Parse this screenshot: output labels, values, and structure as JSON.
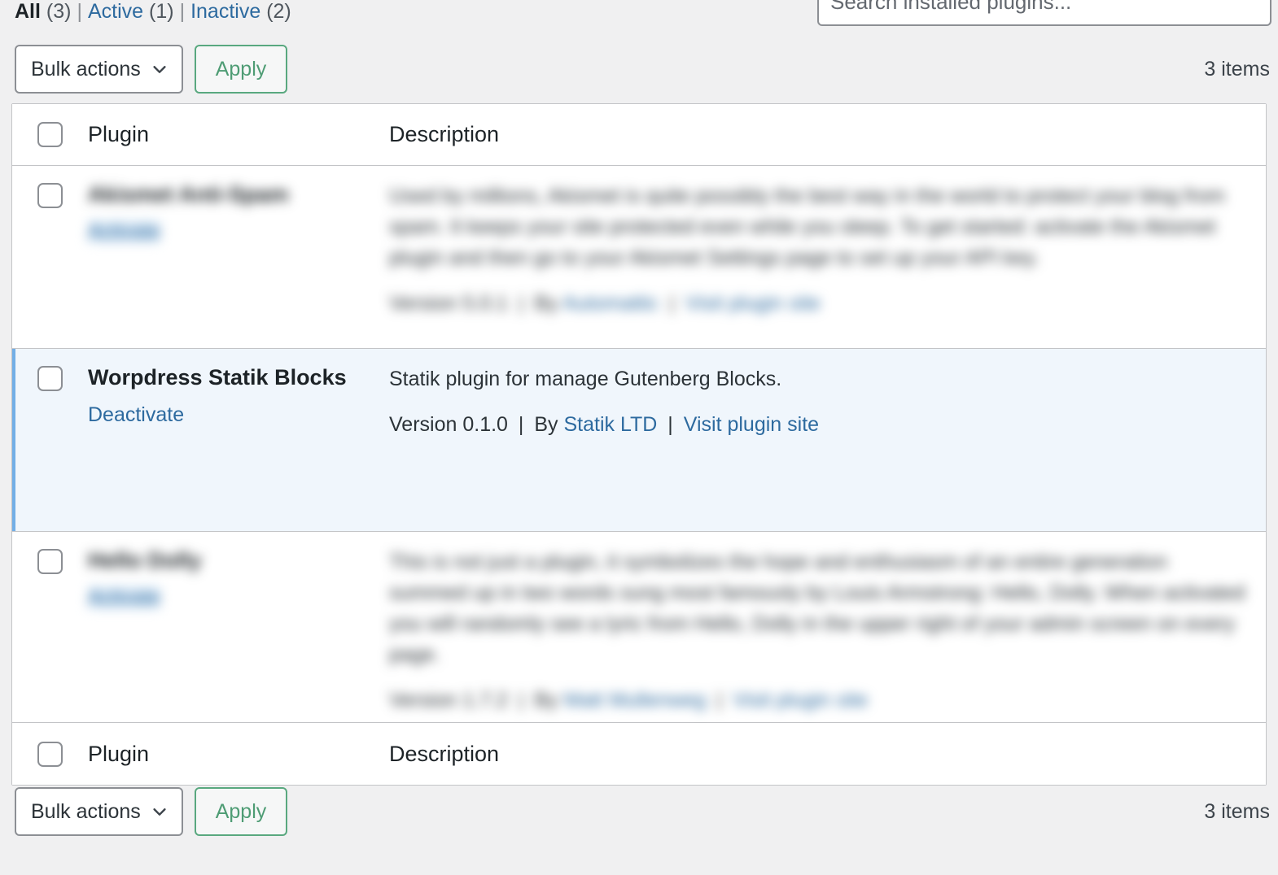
{
  "status_links": {
    "all": {
      "label": "All",
      "count": "(3)",
      "current": true
    },
    "active": {
      "label": "Active",
      "count": "(1)",
      "current": false
    },
    "inactive": {
      "label": "Inactive",
      "count": "(2)",
      "current": false
    },
    "separator": "|"
  },
  "search": {
    "placeholder": "Search installed plugins...",
    "value": ""
  },
  "tablenav": {
    "bulk_actions_label": "Bulk actions",
    "apply_label": "Apply",
    "items_count": "3 items"
  },
  "table": {
    "columns": {
      "plugin": "Plugin",
      "description": "Description"
    },
    "rows": [
      {
        "name": "Akismet Anti-Spam",
        "action_label": "Activate",
        "description": "Used by millions, Akismet is quite possibly the best way in the world to protect your blog from spam. It keeps your site protected even while you sleep. To get started: activate the Akismet plugin and then go to your Akismet Settings page to set up your API key.",
        "version_label": "Version",
        "version": "5.0.1",
        "by_label": "By",
        "author": "Automattic",
        "visit_label": "Visit plugin site",
        "state": "inactive",
        "redacted": true
      },
      {
        "name": "Worpdress Statik Blocks",
        "action_label": "Deactivate",
        "description": "Statik plugin for manage Gutenberg Blocks.",
        "version_label": "Version",
        "version": "0.1.0",
        "by_label": "By",
        "author": "Statik LTD",
        "visit_label": "Visit plugin site",
        "state": "active",
        "redacted": false
      },
      {
        "name": "Hello Dolly",
        "action_label": "Activate",
        "description": "This is not just a plugin, it symbolizes the hope and enthusiasm of an entire generation summed up in two words sung most famously by Louis Armstrong: Hello, Dolly. When activated you will randomly see a lyric from Hello, Dolly in the upper right of your admin screen on every page.",
        "version_label": "Version",
        "version": "1.7.2",
        "by_label": "By",
        "author": "Matt Mullenweg",
        "visit_label": "Visit plugin site",
        "state": "inactive",
        "redacted": true
      }
    ]
  },
  "colors": {
    "background": "#f0f0f1",
    "link": "#2d6a9f",
    "accent_green": "#59a87f",
    "active_row_bg": "#f0f6fc",
    "active_row_border": "#72aee6",
    "table_border": "#c3c4c7"
  },
  "icons": {
    "chevron_down": "chevron-down-icon"
  }
}
